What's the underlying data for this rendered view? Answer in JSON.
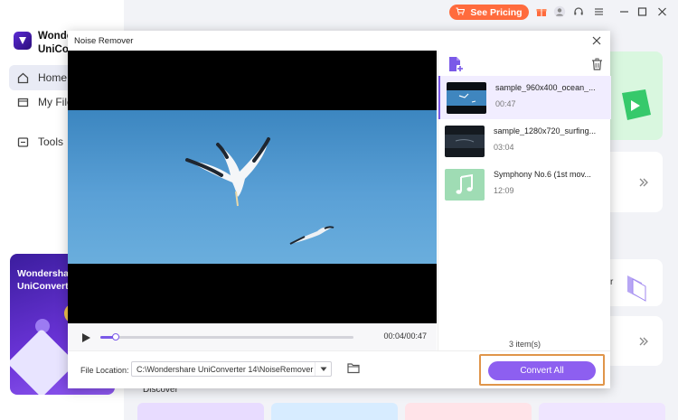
{
  "app": {
    "name_line1": "Wondershare",
    "name_line2": "UniConverter",
    "accent_color": "#8d5ff0"
  },
  "sidebar": {
    "items": [
      {
        "label": "Home",
        "icon": "home-icon",
        "active": true
      },
      {
        "label": "My Files",
        "icon": "file-icon",
        "active": false
      },
      {
        "label": "Tools",
        "icon": "tools-icon",
        "active": false
      }
    ],
    "promo": {
      "line1": "Wondershare",
      "line2": "UniConverter"
    }
  },
  "topbar": {
    "pricing_label": "See Pricing",
    "icons": [
      "cart-icon",
      "gift-icon",
      "user-icon",
      "headset-icon",
      "menu-icon",
      "minimize-icon",
      "maximize-icon",
      "close-icon"
    ]
  },
  "background": {
    "discover_label": "Discover",
    "card_text": "r"
  },
  "modal": {
    "title": "Noise Remover",
    "player": {
      "time": "00:04/00:47",
      "progress_fraction": 0.06
    },
    "files": [
      {
        "name": "sample_960x400_ocean_...",
        "duration": "00:47",
        "selected": true,
        "thumb": "video"
      },
      {
        "name": "sample_1280x720_surfing...",
        "duration": "03:04",
        "selected": false,
        "thumb": "video-dark"
      },
      {
        "name": "Symphony No.6 (1st mov...",
        "duration": "12:09",
        "selected": false,
        "thumb": "music"
      }
    ],
    "item_count": "3 item(s)",
    "file_location_label": "File Location:",
    "file_location_value": "C:\\Wondershare UniConverter 14\\NoiseRemover",
    "convert_label": "Convert All"
  }
}
